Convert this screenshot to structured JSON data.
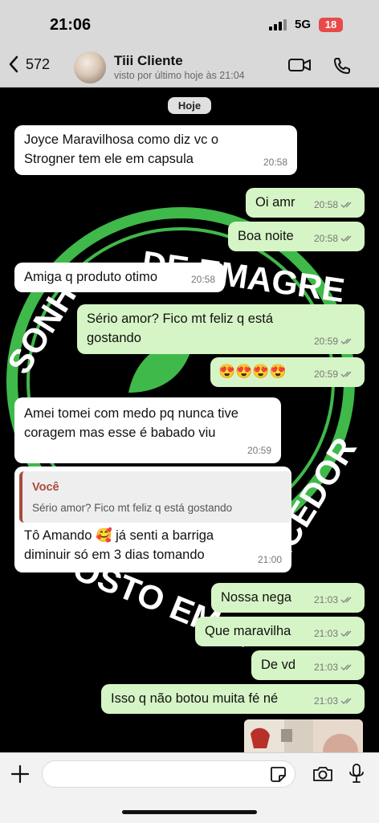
{
  "status_bar": {
    "time": "21:06",
    "network": "5G",
    "battery": "18"
  },
  "header": {
    "back_count": "572",
    "contact_name": "Tiii Cliente",
    "contact_status": "visto por último hoje às 21:04"
  },
  "chat": {
    "date_label": "Hoje",
    "watermark_text": "SONHO DE EMAGRECER · OSTO EM AGRADECEDOR",
    "messages": [
      {
        "text_1": "Joyce Maravilhosa como diz vc o",
        "text_2": "Strogner tem ele em capsula",
        "time": "20:58"
      },
      {
        "text": "Oi amr",
        "time": "20:58"
      },
      {
        "text": "Boa noite",
        "time": "20:58"
      },
      {
        "text": "Amiga q produto otimo",
        "time": "20:58"
      },
      {
        "text_1": "Sério amor? Fico mt feliz q está",
        "text_2": "gostando",
        "time": "20:59"
      },
      {
        "text": "😍😍😍😍",
        "time": "20:59"
      },
      {
        "text_1": "Amei tomei com medo pq nunca tive",
        "text_2": "coragem mas esse é babado viu",
        "time": "20:59"
      },
      {
        "quote_author": "Você",
        "quote_text": "Sério amor? Fico mt feliz q está gostando",
        "text_1": "Tô Amando 🥰 já senti a barriga",
        "text_2": "diminuir só em 3 dias tomando",
        "time": "21:00"
      },
      {
        "text": "Nossa nega",
        "time": "21:03"
      },
      {
        "text": "Que maravilha",
        "time": "21:03"
      },
      {
        "text": "De vd",
        "time": "21:03"
      },
      {
        "text": "Isso q não botou muita fé né",
        "time": "21:03"
      }
    ]
  },
  "composer": {
    "placeholder": ""
  },
  "colors": {
    "incoming": "#ffffff",
    "outgoing": "#d6f5c6",
    "quote_accent": "#a84b3c",
    "watermark_green": "#3fb94a",
    "battery": "#e84a4a"
  }
}
